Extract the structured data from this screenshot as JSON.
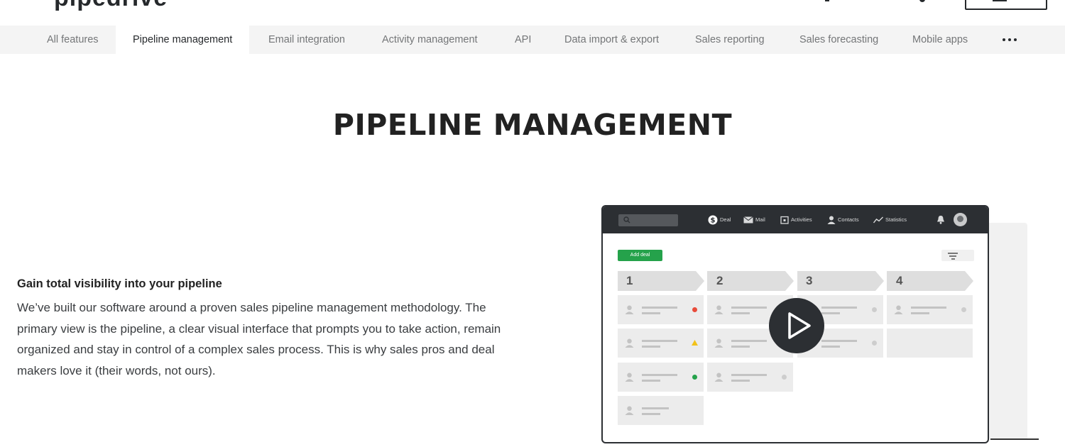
{
  "header": {
    "logo_text": "pipedrive"
  },
  "feature_nav": {
    "items": [
      {
        "label": "All features"
      },
      {
        "label": "Pipeline management",
        "active": true
      },
      {
        "label": "Email integration"
      },
      {
        "label": "Activity management"
      },
      {
        "label": "API"
      },
      {
        "label": "Data import & export"
      },
      {
        "label": "Sales reporting"
      },
      {
        "label": "Sales forecasting"
      },
      {
        "label": "Mobile apps"
      }
    ],
    "more_icon": "more-dots-icon"
  },
  "main": {
    "title": "PIPELINE MANAGEMENT",
    "subheading": "Gain total visibility into your pipeline",
    "body": "We’ve built our software around a proven sales pipeline management methodology. The primary view is the pipeline, a clear visual interface that prompts you to take action, remain organized and stay in control of a complex sales process. This is why sales pros and deal makers love it (their words, not ours)."
  },
  "mockup": {
    "nav": [
      {
        "label": "Deal",
        "icon": "dollar-icon"
      },
      {
        "label": "Mail",
        "icon": "mail-icon"
      },
      {
        "label": "Activities",
        "icon": "calendar-icon"
      },
      {
        "label": "Contacts",
        "icon": "person-icon"
      },
      {
        "label": "Statistics",
        "icon": "chart-icon"
      }
    ],
    "add_deal_label": "Add deal",
    "stages": [
      "1",
      "2",
      "3",
      "4"
    ],
    "status_colors": {
      "red": "#e84b3a",
      "yellow": "#f2c21a",
      "green": "#25a24b",
      "gray": "#cdcdcd"
    },
    "accent": "#25a24b",
    "play_icon": "play-icon"
  }
}
